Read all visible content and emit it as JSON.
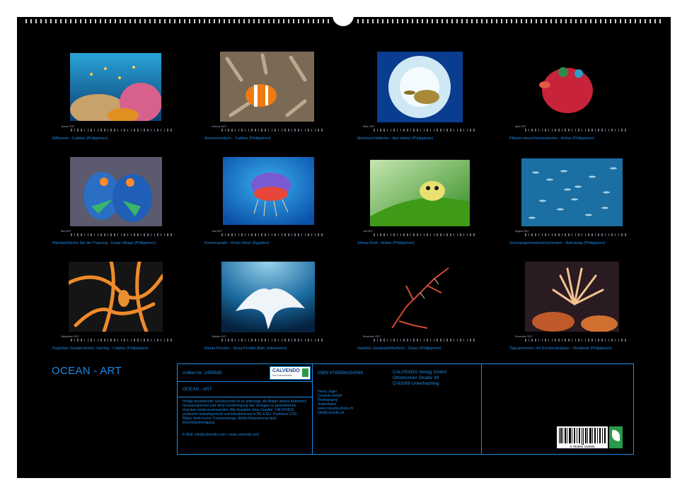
{
  "title": "OCEAN - ART",
  "months": [
    {
      "label": "Januar 2027",
      "caption": "Riffszene - Cabilao (Philippinen)"
    },
    {
      "label": "Februar 2027",
      "caption": "Anemonenfisch - Cabilao (Philippinen)"
    },
    {
      "label": "März 2027",
      "caption": "Meeresschildkröte - Apo Island (Philippinen)"
    },
    {
      "label": "April 2027",
      "caption": "Pfauen-Heuschreckenkrebs - Anilao (Philippinen)"
    },
    {
      "label": "Mai 2027",
      "caption": "Mandarinfische bei der Paarung - Kasai Village (Philippinen)"
    },
    {
      "label": "Juni 2027",
      "caption": "Kronenqualle - Rotes Meer (Ägypten)"
    },
    {
      "label": "Juli 2027",
      "caption": "Sheep Nudi - Anilao (Philippinen)"
    },
    {
      "label": "August 2027",
      "caption": "Grossaugenmakrelenschwarm - Balicasag (Philippinen)"
    },
    {
      "label": "September 2027",
      "caption": "Pygmäen Seepferdchen, trächtig - Cabilao (Philippinen)"
    },
    {
      "label": "Oktober 2027",
      "caption": "Manta Rochen - Nusa Penida (Bali, Indonesien)"
    },
    {
      "label": "November 2027",
      "caption": "Harlekin Geisterpfeifenfisch - Dauin (Philippinen)"
    },
    {
      "label": "Dezember 2027",
      "caption": "Tigeranemone mit Korallenpolypen - Moalboal (Philippinen)"
    }
  ],
  "info": {
    "article": "Artikel-Nr. 2459585",
    "subtitle": "OCEAN - ART",
    "isbn": "ISBN 9783594150566",
    "publisher": [
      "CALVENDO Verlag GmbH",
      "Ottobrunner Straße 39",
      "D-82008 Unterhaching"
    ],
    "legal": "Infolge bestehender Schutzrechte ist es untersagt, die Blätter dieses Kalenders herauszutrennen und ohne Genehmigung des Verlages zu gewerblichen Zwecken weiterzuverwenden. Alle Angaben ohne Gewähr. CALVENDO produziert bedarfsgerecht und klimabewusst in DE & EU. Positivere CO2-Bilanz dank kurzer Transportwege. Abfall-Reduzierung dank Einzelstückfertigung.",
    "email": "E-Mail: info@calvendo.com • www.calvendo.com",
    "author": [
      "Henry Jager",
      "Conartix GmbH",
      "Photography",
      "Switzerland",
      "www.conartix-photo.ch",
      "info@conartix.ch"
    ],
    "logo_text": "CALVENDO",
    "logo_sub": "Ihre Kalenderwelt",
    "barcode_number": "9 783594 150566",
    "colors": {
      "accent": "#1c8be6",
      "background": "#000000",
      "eco": "#2a9a4a"
    }
  }
}
